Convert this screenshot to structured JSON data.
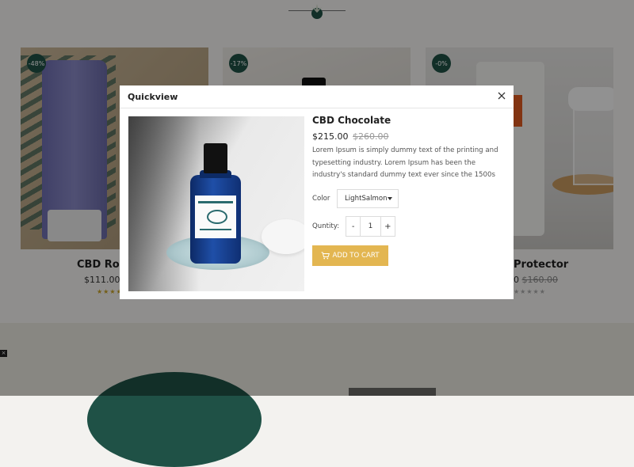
{
  "background": {
    "products": [
      {
        "discount": "-48%",
        "title": "CBD Roll-",
        "price": "$111.00",
        "old_price": "$",
        "stars": "★★★★★"
      },
      {
        "discount": "-17%"
      },
      {
        "discount": "-0%",
        "title": "Protector",
        "price": "0",
        "old_price": "$160.00",
        "stars": "★★★★★"
      }
    ]
  },
  "modal": {
    "title": "Quickview",
    "product": {
      "name": "CBD Chocolate",
      "price": "$215.00",
      "old_price": "$260.00",
      "description": "Lorem Ipsum is simply dummy text of the printing and typesetting industry. Lorem Ipsum has been the industry's standard dummy text ever since the 1500s",
      "color_label": "Color",
      "color_value": "LightSalmon",
      "quantity_label": "Quntity:",
      "quantity_value": "1",
      "minus": "-",
      "plus": "+",
      "add_to_cart": "ADD TO CART"
    }
  },
  "colors": {
    "accent": "#e3b651",
    "brand": "#1f5146"
  }
}
